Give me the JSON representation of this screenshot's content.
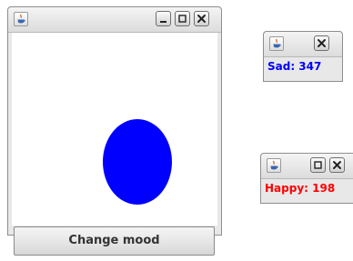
{
  "main_window": {
    "button_label": "Change mood",
    "mood_color": "#0000ff"
  },
  "sad_window": {
    "status_text": "Sad: 347",
    "status_color": "#0000ff"
  },
  "happy_window": {
    "status_text": "Happy: 198",
    "status_color": "#ff0000"
  },
  "icons": {
    "app": "java-app-icon",
    "minimize": "minimize-icon",
    "maximize": "maximize-icon",
    "close": "close-icon"
  }
}
